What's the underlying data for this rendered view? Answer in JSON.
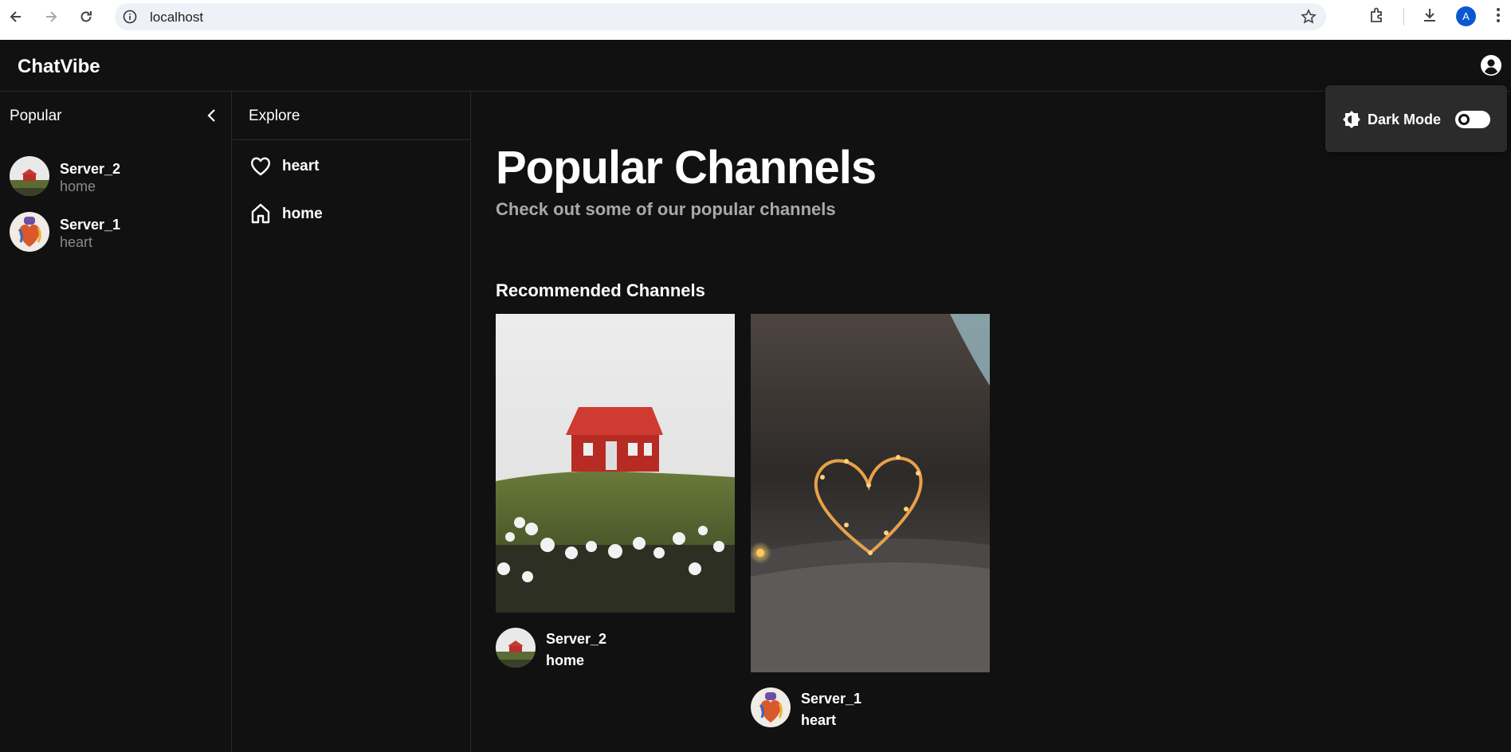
{
  "browser": {
    "url": "localhost",
    "profile_initial": "A"
  },
  "app": {
    "brand": "ChatVibe"
  },
  "popular_sidebar": {
    "title": "Popular",
    "items": [
      {
        "name": "Server_2",
        "sub": "home",
        "avatar": "red-house"
      },
      {
        "name": "Server_1",
        "sub": "heart",
        "avatar": "heart-art"
      }
    ]
  },
  "explore_sidebar": {
    "title": "Explore",
    "items": [
      {
        "label": "heart",
        "icon": "heart-icon"
      },
      {
        "label": "home",
        "icon": "home-icon"
      }
    ]
  },
  "main": {
    "title": "Popular Channels",
    "subtitle": "Check out some of our popular channels",
    "section_title": "Recommended Channels",
    "cards": [
      {
        "name": "Server_2",
        "sub": "home",
        "image": "red-house-photo"
      },
      {
        "name": "Server_1",
        "sub": "heart",
        "image": "heart-lights-photo"
      }
    ]
  },
  "dark_mode_popup": {
    "label": "Dark Mode",
    "enabled": false
  },
  "colors": {
    "background": "#111111",
    "border": "#2a2a2a",
    "muted_text": "#8a8a8a",
    "subtitle_text": "#a9a9a9",
    "popup_bg": "#2b2b2b"
  }
}
